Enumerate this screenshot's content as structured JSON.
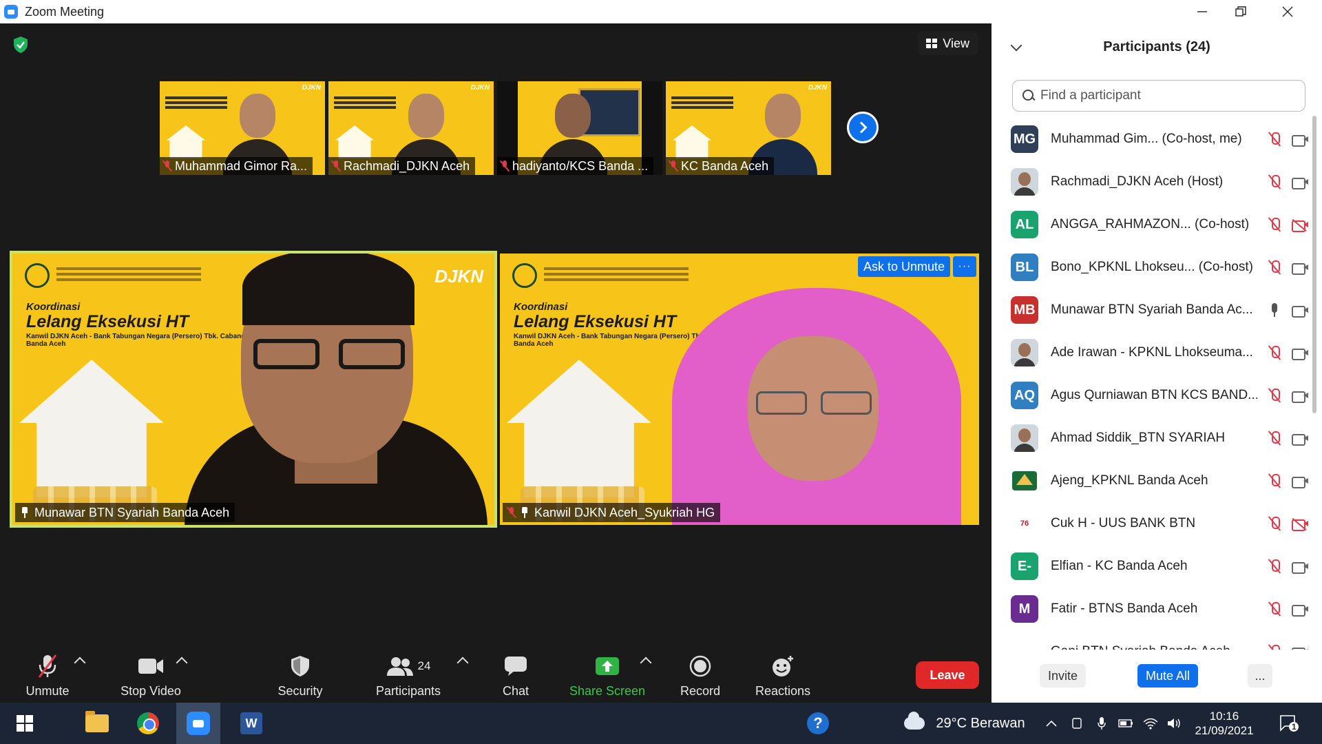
{
  "window": {
    "title": "Zoom Meeting"
  },
  "stage": {
    "view_label": "View",
    "thumbnails": [
      {
        "name": "Muhammad Gimor Ra...",
        "muted": true
      },
      {
        "name": "Rachmadi_DJKN Aceh",
        "muted": true
      },
      {
        "name": "hadiyanto/KCS Banda ...",
        "muted": true
      },
      {
        "name": "KC Banda Aceh",
        "muted": true
      }
    ],
    "tiles": [
      {
        "name": "Munawar BTN Syariah Banda Aceh",
        "pinned": true,
        "active_speaker": true
      },
      {
        "name": "Kanwil DJKN Aceh_Syukriah HG",
        "pinned": true,
        "muted": true,
        "ask_label": "Ask to Unmute",
        "more_label": "···"
      }
    ],
    "slide": {
      "brand": "DJKN",
      "line1": "Koordinasi",
      "line2": "Lelang Eksekusi HT",
      "line3": "Kanwil DJKN Aceh - Bank Tabungan Negara (Persero) Tbk. Cabang Banda Aceh"
    }
  },
  "toolbar": {
    "unmute": "Unmute",
    "stop_video": "Stop Video",
    "security": "Security",
    "participants": "Participants",
    "participants_count": "24",
    "chat": "Chat",
    "share_screen": "Share Screen",
    "record": "Record",
    "reactions": "Reactions",
    "leave": "Leave"
  },
  "panel": {
    "title": "Participants (24)",
    "search_placeholder": "Find a participant",
    "invite": "Invite",
    "mute_all": "Mute All",
    "more": "...",
    "participants": [
      {
        "initials": "MG",
        "color": "#2e3f57",
        "name": "Muhammad Gim... (Co-host, me)",
        "mic": "off",
        "cam": "on"
      },
      {
        "initials": "",
        "color": "photo",
        "name": "Rachmadi_DJKN Aceh (Host)",
        "mic": "off",
        "cam": "on"
      },
      {
        "initials": "AL",
        "color": "#1aa36f",
        "name": "ANGGA_RAHMAZON... (Co-host)",
        "mic": "off",
        "cam": "off"
      },
      {
        "initials": "BL",
        "color": "#2f7fc1",
        "name": "Bono_KPKNL Lhokseu... (Co-host)",
        "mic": "off",
        "cam": "on"
      },
      {
        "initials": "MB",
        "color": "#c8302f",
        "name": "Munawar BTN Syariah Banda Ac...",
        "mic": "on",
        "cam": "on"
      },
      {
        "initials": "",
        "color": "photo",
        "name": "Ade Irawan - KPKNL Lhokseuma...",
        "mic": "off",
        "cam": "on"
      },
      {
        "initials": "AQ",
        "color": "#2f7fc1",
        "name": "Agus Qurniawan BTN KCS BAND...",
        "mic": "off",
        "cam": "on"
      },
      {
        "initials": "",
        "color": "photo",
        "name": "Ahmad Siddik_BTN SYARIAH",
        "mic": "off",
        "cam": "on"
      },
      {
        "initials": "",
        "color": "logo2",
        "name": "Ajeng_KPKNL Banda Aceh",
        "mic": "off",
        "cam": "on"
      },
      {
        "initials": "76",
        "color": "logo",
        "name": "Cuk H - UUS BANK BTN",
        "mic": "off",
        "cam": "off"
      },
      {
        "initials": "E-",
        "color": "#1aa36f",
        "name": "Elfian - KC Banda Aceh",
        "mic": "off",
        "cam": "on"
      },
      {
        "initials": "M",
        "color": "#6a2c91",
        "name": "Fatir - BTNS Banda Aceh",
        "mic": "off",
        "cam": "on"
      },
      {
        "initials": "",
        "color": "logo",
        "name": "Gani BTN Syariah Banda Aceh",
        "mic": "off",
        "cam": "on"
      }
    ]
  },
  "taskbar": {
    "weather": "29°C  Berawan",
    "time": "10:16",
    "date": "21/09/2021",
    "notifications": "1"
  }
}
